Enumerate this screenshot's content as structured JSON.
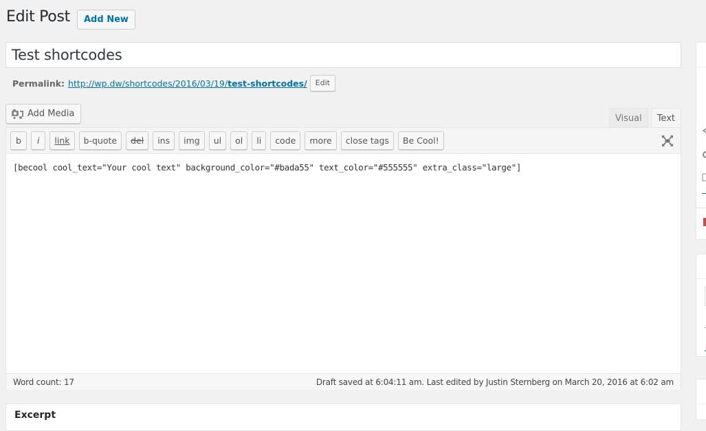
{
  "header": {
    "title": "Edit Post",
    "add_new_label": "Add New"
  },
  "post": {
    "title": "Test shortcodes",
    "permalink_label": "Permalink:",
    "permalink_base": "http://wp.dw/shortcodes/2016/03/19/",
    "permalink_slug": "test-shortcodes/",
    "permalink_edit_label": "Edit"
  },
  "media": {
    "add_media_label": "Add Media"
  },
  "editor": {
    "tabs": [
      {
        "label": "Visual",
        "active": false
      },
      {
        "label": "Text",
        "active": true
      }
    ],
    "quicktags": [
      "b",
      "i",
      "link",
      "b-quote",
      "del",
      "ins",
      "img",
      "ul",
      "ol",
      "li",
      "code",
      "more",
      "close tags",
      "Be Cool!"
    ],
    "content": "[becool cool_text=\"Your cool text\" background_color=\"#bada55\" text_color=\"#555555\" extra_class=\"large\"]",
    "word_count": "Word count: 17",
    "save_status": "Draft saved at 6:04:11 am. Last edited by Justin Sternberg on March 20, 2016 at 6:02 am"
  },
  "excerpt": {
    "title": "Excerpt"
  },
  "colors": {
    "accent": "#0073aa",
    "background": "#f1f1f1"
  }
}
